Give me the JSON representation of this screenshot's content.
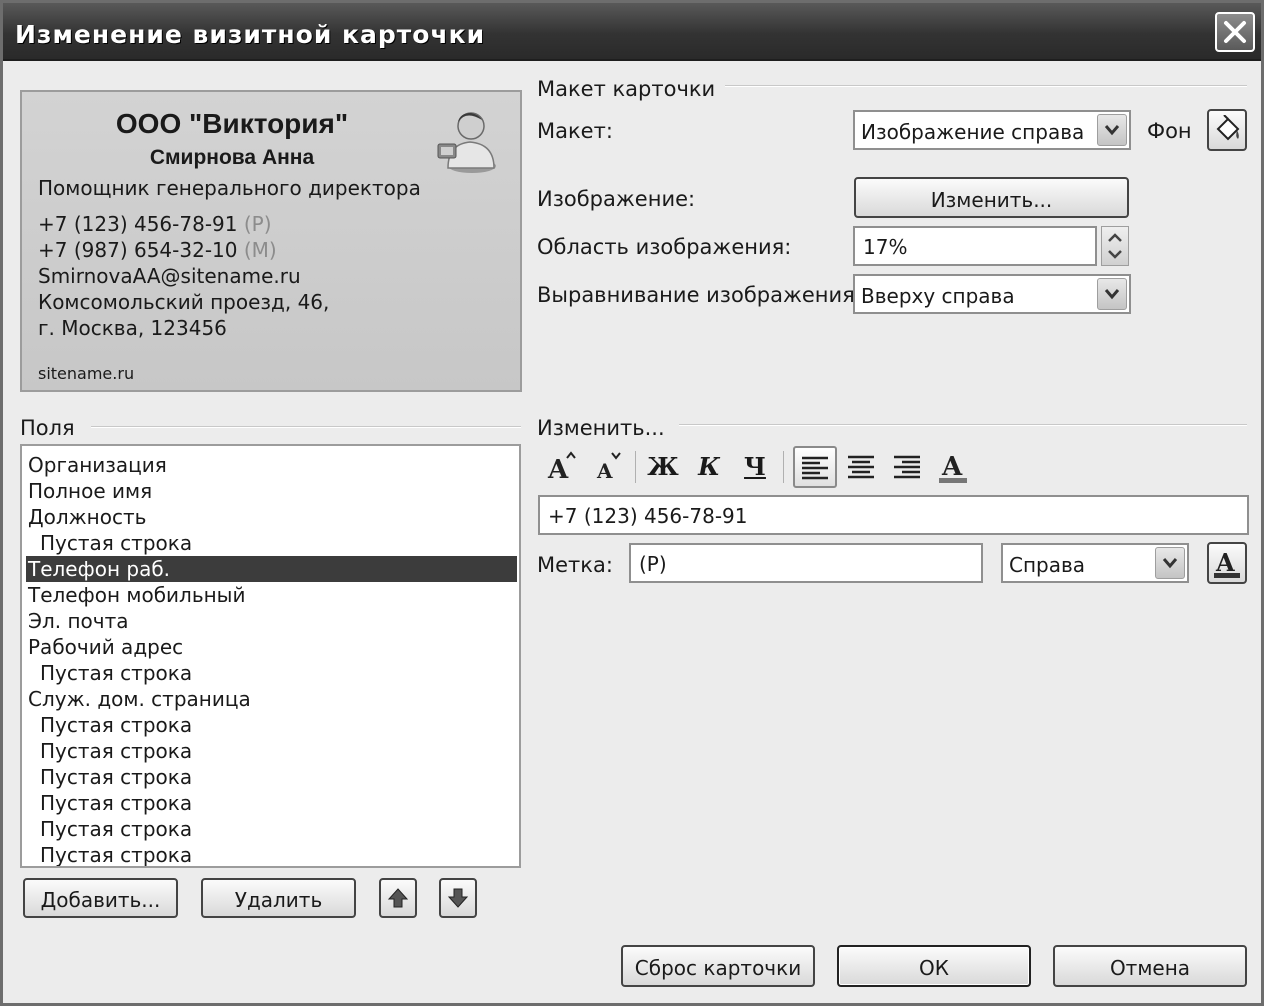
{
  "window": {
    "title": "Изменение визитной карточки"
  },
  "card": {
    "company": "ООО \"Виктория\"",
    "name": "Смирнова Анна",
    "position": "Помощник генерального директора",
    "phone_work": "+7 (123) 456-78-91",
    "phone_work_tag": "(P)",
    "phone_mobile": "+7 (987) 654-32-10",
    "phone_mobile_tag": "(M)",
    "email": "SmirnovaAA@sitename.ru",
    "address1": "Комсомольский проезд, 46,",
    "address2": "г. Москва, 123456",
    "site": "sitename.ru",
    "avatar_icon": "person-avatar-icon"
  },
  "layout_group": {
    "title": "Макет карточки",
    "layout_label": "Макет:",
    "layout_value": "Изображение справа",
    "background_label": "Фон",
    "image_label": "Изображение:",
    "image_button": "Изменить...",
    "image_area_label": "Область изображения:",
    "image_area_value": "17%",
    "image_align_label": "Выравнивание изображения:",
    "image_align_value": "Вверху справа"
  },
  "fields": {
    "title": "Поля",
    "items": [
      {
        "label": "Организация",
        "indent": false,
        "selected": false
      },
      {
        "label": "Полное имя",
        "indent": false,
        "selected": false
      },
      {
        "label": "Должность",
        "indent": false,
        "selected": false
      },
      {
        "label": "Пустая строка",
        "indent": true,
        "selected": false
      },
      {
        "label": "Телефон раб.",
        "indent": false,
        "selected": true
      },
      {
        "label": "Телефон мобильный",
        "indent": false,
        "selected": false
      },
      {
        "label": "Эл. почта",
        "indent": false,
        "selected": false
      },
      {
        "label": "Рабочий адрес",
        "indent": false,
        "selected": false
      },
      {
        "label": "Пустая строка",
        "indent": true,
        "selected": false
      },
      {
        "label": "Служ. дом. страница",
        "indent": false,
        "selected": false
      },
      {
        "label": "Пустая строка",
        "indent": true,
        "selected": false
      },
      {
        "label": "Пустая строка",
        "indent": true,
        "selected": false
      },
      {
        "label": "Пустая строка",
        "indent": true,
        "selected": false
      },
      {
        "label": "Пустая строка",
        "indent": true,
        "selected": false
      },
      {
        "label": "Пустая строка",
        "indent": true,
        "selected": false
      },
      {
        "label": "Пустая строка",
        "indent": true,
        "selected": false
      }
    ],
    "add_button": "Добавить...",
    "delete_button": "Удалить"
  },
  "edit_group": {
    "title": "Изменить...",
    "toolbar": {
      "bold": "Ж",
      "italic": "К",
      "underline": "Ч"
    },
    "field_value": "+7 (123) 456-78-91",
    "tag_label": "Метка:",
    "tag_value": "(P)",
    "tag_position": "Справа"
  },
  "footer": {
    "reset_button": "Сброс карточки",
    "ok_button": "ОК",
    "cancel_button": "Отмена"
  }
}
